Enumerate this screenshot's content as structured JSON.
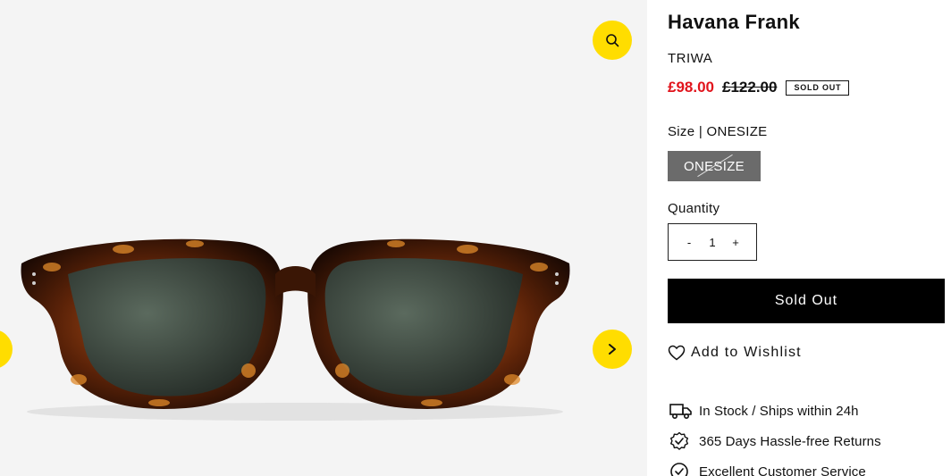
{
  "product": {
    "title": "Havana Frank",
    "brand": "TRIWA",
    "price_sale": "£98.00",
    "price_regular": "£122.00",
    "badge": "SOLD OUT",
    "size_label": "Size | ONESIZE",
    "size_option": "ONESIZE",
    "quantity_label": "Quantity",
    "quantity_minus": "-",
    "quantity_value": "1",
    "quantity_plus": "+",
    "cta_label": "Sold Out",
    "wishlist_label": "Add to Wishlist"
  },
  "features": [
    {
      "icon": "truck-icon",
      "text": "In Stock / Ships within 24h"
    },
    {
      "icon": "badge-check-icon",
      "text": "365 Days Hassle-free Returns"
    },
    {
      "icon": "circle-check-icon",
      "text": "Excellent Customer Service"
    }
  ],
  "colors": {
    "accent": "#ffdd00",
    "sale": "#e1141c",
    "cta": "#000000",
    "size_selected": "#6b6b6b"
  }
}
